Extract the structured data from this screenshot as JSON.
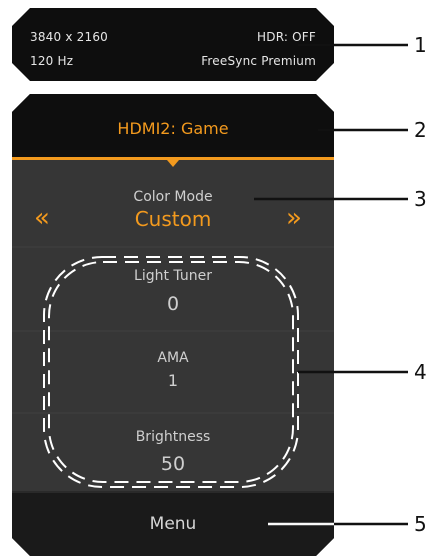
{
  "status": {
    "resolution": "3840 x 2160",
    "hdr": "HDR: OFF",
    "refresh_rate": "120 Hz",
    "sync": "FreeSync Premium"
  },
  "header": {
    "input_mode": "HDMI2: Game"
  },
  "color_mode": {
    "label": "Color Mode",
    "value": "Custom",
    "prev_icon": "double-chevron-left-icon",
    "next_icon": "double-chevron-right-icon"
  },
  "quick_settings": [
    {
      "label": "Light Tuner",
      "value": "0"
    },
    {
      "label": "AMA",
      "value": "1"
    },
    {
      "label": "Brightness",
      "value": "50"
    }
  ],
  "footer": {
    "menu_label": "Menu"
  },
  "callouts": [
    "1",
    "2",
    "3",
    "4",
    "5"
  ],
  "colors": {
    "accent": "#F39A1E",
    "panel_dark": "#0E0E0E",
    "panel": "#363636",
    "text": "#CFCFCF"
  }
}
